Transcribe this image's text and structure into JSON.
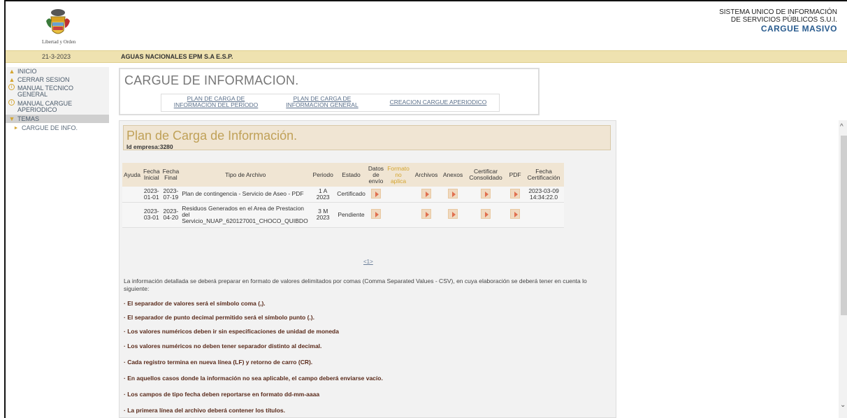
{
  "header": {
    "logo_caption": "Libertad y Orden",
    "system_line1": "SISTEMA UNICO DE INFORMACIÓN",
    "system_line2": "DE SERVICIOS PÚBLICOS S.U.I.",
    "system_line3": "CARGUE MASIVO"
  },
  "band": {
    "date": "21-3-2023",
    "company": "AGUAS NACIONALES EPM S.A E.S.P."
  },
  "sidebar": {
    "items": [
      {
        "label": "INICIO"
      },
      {
        "label": "CERRAR SESION"
      },
      {
        "label": "MANUAL TECNICO GENERAL"
      },
      {
        "label": "MANUAL CARGUE APERIODICO"
      },
      {
        "label": "TEMAS"
      },
      {
        "label": "CARGUE DE INFO."
      }
    ]
  },
  "cargue": {
    "title": "CARGUE DE INFORMACION.",
    "links": [
      {
        "line1": "PLAN DE CARGA DE",
        "line2": "INFORMACION DEL PERIODO"
      },
      {
        "line1": "PLAN DE CARGA DE",
        "line2": "INFORMACION GENERAL"
      },
      {
        "line1": "CREACION CARGUE APERIODICO",
        "line2": ""
      }
    ]
  },
  "plan": {
    "title": "Plan de Carga de Información.",
    "id_label": "Id empresa:3280"
  },
  "table": {
    "headers": [
      "Ayuda",
      "Fecha Inicial",
      "Fecha Final",
      "Tipo de Archivo",
      "Periodo",
      "Estado",
      "Datos de envío",
      "Formato no aplica",
      "Archivos",
      "Anexos",
      "Certificar Consolidado",
      "PDF",
      "Fecha Certificación"
    ],
    "rows": [
      {
        "ayuda": "",
        "fecha_inicial": "2023-01-01",
        "fecha_final": "2023-07-19",
        "tipo": "Plan de contingencia - Servicio de Aseo - PDF",
        "periodo": "1 A 2023",
        "estado": "Certificado",
        "fecha_cert": "2023-03-09 14:34:22.0"
      },
      {
        "ayuda": "",
        "fecha_inicial": "2023-03-01",
        "fecha_final": "2023-04-20",
        "tipo": "Residuos Generados en el Area de Prestacion del Servicio_NUAP_620127001_CHOCO_QUIBDO",
        "periodo": "3 M 2023",
        "estado": "Pendiente",
        "fecha_cert": ""
      }
    ]
  },
  "pager": "<1>",
  "info_text": "La información detallada se deberá preparar en formato de valores delimitados por comas (Comma Separated Values - CSV), en cuya elaboración se deberá tener en cuenta lo siguiente:",
  "rules": [
    "· El separador de valores será el símbolo coma (,).",
    "· El separador de punto decimal permitido será el símbolo punto (.).",
    "· Los valores numéricos deben ir sin especificaciones de unidad de moneda",
    "· Los valores numéricos no deben tener separador distinto al decimal.",
    "· Cada registro termina en nueva línea (LF) y retorno de carro (CR).",
    "· En aquellos casos donde la información no sea aplicable, el campo deberá enviarse vacío.",
    "· Los campos de tipo fecha deben reportarse en formato dd-mm-aaaa",
    "· La primera línea del archivo deberá contener los títulos."
  ],
  "colors": {
    "band": "#efe2b0",
    "accent_gold": "#d4a530",
    "link_blue": "#5a6f8a",
    "brand_blue": "#2a5c8f"
  }
}
